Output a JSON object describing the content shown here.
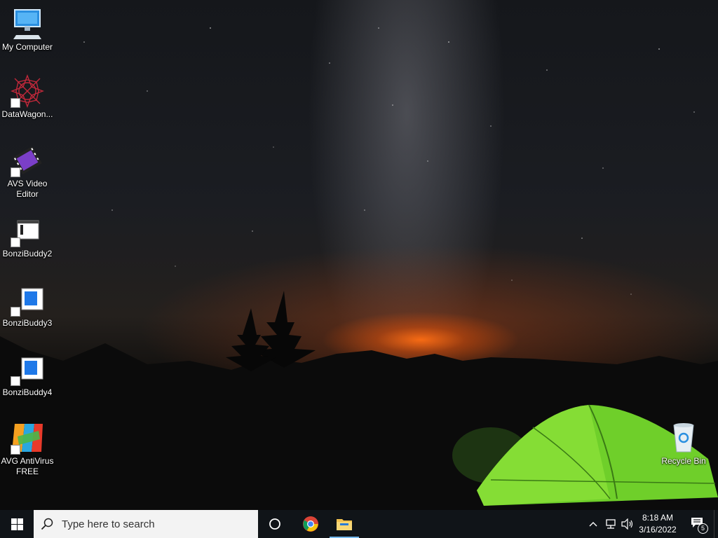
{
  "desktop": {
    "icons": [
      {
        "label": "My Computer",
        "icon": "monitor-icon"
      },
      {
        "label": "DataWagon...",
        "icon": "red-star-icon"
      },
      {
        "label": "AVS Video Editor",
        "icon": "film-strip-icon"
      },
      {
        "label": "BonziBuddy2",
        "icon": "window-icon"
      },
      {
        "label": "BonziBuddy3",
        "icon": "blue-window-icon"
      },
      {
        "label": "BonziBuddy4",
        "icon": "blue-window-icon"
      },
      {
        "label": "AVG AntiVirus FREE",
        "icon": "avg-logo-icon"
      },
      {
        "label": "Recycle Bin",
        "icon": "recycle-bin-icon"
      }
    ]
  },
  "taskbar": {
    "search_placeholder": "Type here to search",
    "pinned": [
      {
        "name": "Google Chrome",
        "icon": "chrome-icon"
      },
      {
        "name": "File Explorer",
        "icon": "folder-icon",
        "active": true
      }
    ],
    "clock": {
      "time": "8:18 AM",
      "date": "3/16/2022"
    },
    "notifications_count": "5",
    "colors": {
      "taskbar": "#101418",
      "search_bg": "#f3f3f3",
      "active_indicator": "#76b9ed"
    }
  }
}
